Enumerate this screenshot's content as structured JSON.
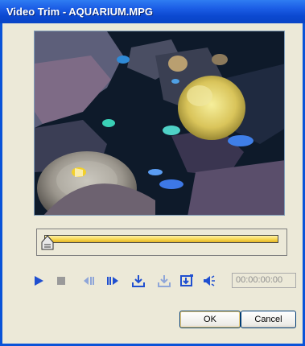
{
  "window": {
    "title": "Video Trim - AQUARIUM.MPG"
  },
  "video": {
    "description_icon": "video-frame"
  },
  "trim": {
    "handle_icon": "trim-start-handle-icon"
  },
  "controls": {
    "icons": [
      "play-icon",
      "stop-icon",
      "prev-frame-icon",
      "next-frame-icon",
      "mark-in-icon",
      "mark-out-icon",
      "snapshot-icon",
      "volume-icon"
    ],
    "timecode": "00:00:00:00"
  },
  "buttons": {
    "ok_label": "OK",
    "cancel_label": "Cancel"
  },
  "colors": {
    "titlebar": "#0b48d0",
    "control_blue": "#1f4fd0",
    "trim_bar": "#f5d34a"
  }
}
